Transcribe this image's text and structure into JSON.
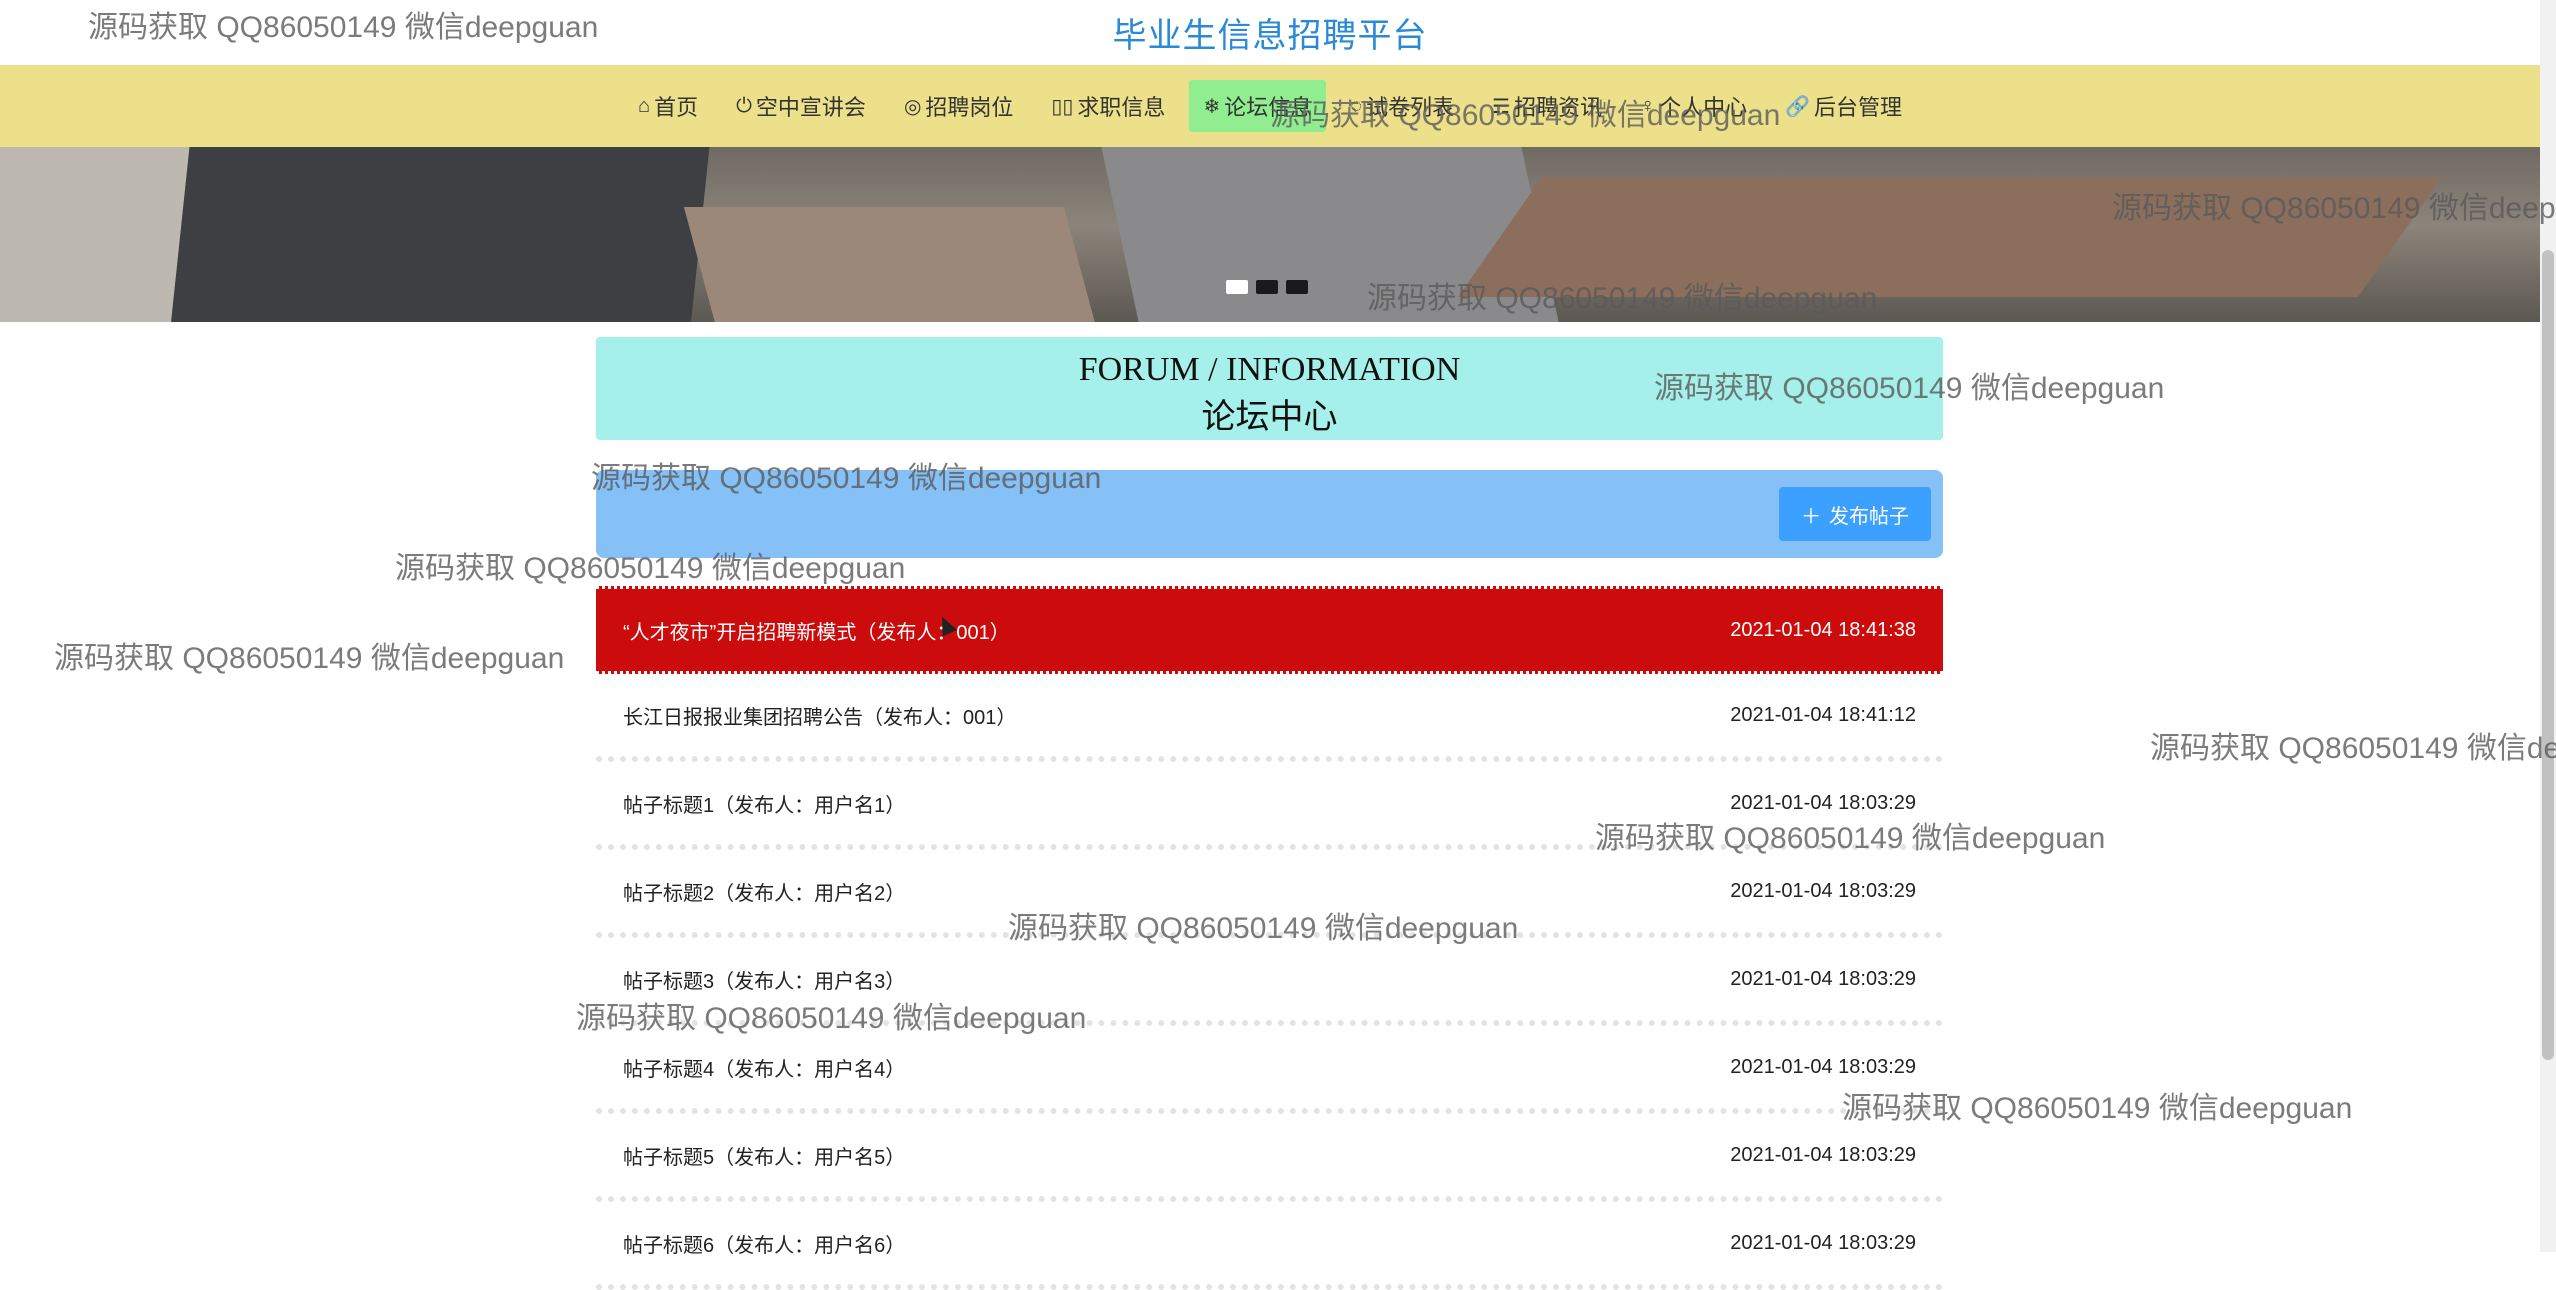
{
  "site_title": "毕业生信息招聘平台",
  "nav": [
    {
      "icon": "⌂",
      "icon_name": "home-icon",
      "label": "首页"
    },
    {
      "icon": "⏻",
      "icon_name": "power-icon",
      "label": "空中宣讲会"
    },
    {
      "icon": "◎",
      "icon_name": "target-icon",
      "label": "招聘岗位"
    },
    {
      "icon": "▯▯",
      "icon_name": "book-icon",
      "label": "求职信息"
    },
    {
      "icon": "❄",
      "icon_name": "snowflake-icon",
      "label": "论坛信息",
      "active": true
    },
    {
      "icon": "◌",
      "icon_name": "paper-icon",
      "label": "试卷列表"
    },
    {
      "icon": "☴",
      "icon_name": "list-icon",
      "label": "招聘资讯"
    },
    {
      "icon": "♀",
      "icon_name": "user-icon",
      "label": "个人中心"
    },
    {
      "icon": "🔗",
      "icon_name": "link-icon",
      "label": "后台管理"
    }
  ],
  "forum": {
    "title_en": "FORUM / INFORMATION",
    "title_cn": "论坛中心",
    "publish_label": "发布帖子"
  },
  "posts": [
    {
      "title": "“人才夜市”开启招聘新模式（发布人：001）",
      "time": "2021-01-04 18:41:38"
    },
    {
      "title": "长江日报报业集团招聘公告（发布人：001）",
      "time": "2021-01-04 18:41:12"
    },
    {
      "title": "帖子标题1（发布人：用户名1）",
      "time": "2021-01-04 18:03:29"
    },
    {
      "title": "帖子标题2（发布人：用户名2）",
      "time": "2021-01-04 18:03:29"
    },
    {
      "title": "帖子标题3（发布人：用户名3）",
      "time": "2021-01-04 18:03:29"
    },
    {
      "title": "帖子标题4（发布人：用户名4）",
      "time": "2021-01-04 18:03:29"
    },
    {
      "title": "帖子标题5（发布人：用户名5）",
      "time": "2021-01-04 18:03:29"
    },
    {
      "title": "帖子标题6（发布人：用户名6）",
      "time": "2021-01-04 18:03:29"
    }
  ],
  "watermark_text": "源码获取 QQ86050149 微信deepguan",
  "colors": {
    "accent": "#2a8ad8",
    "nav_bg": "#ede08a",
    "active_nav": "#90ee90",
    "forum_header_bg": "#a5f0ea",
    "action_bar_bg": "#85c1f7",
    "button_bg": "#3ba0ff",
    "highlight_row": "#cc0c0c"
  }
}
